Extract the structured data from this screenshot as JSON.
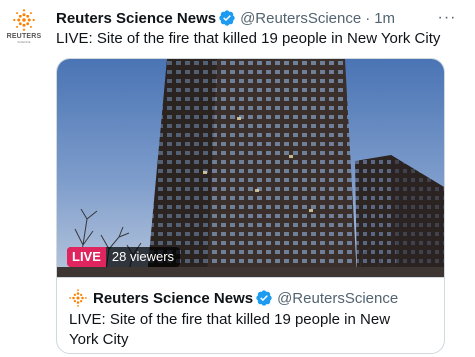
{
  "author": {
    "display_name": "Reuters Science News",
    "handle": "@ReutersScience",
    "separator": "·",
    "timestamp": "1m",
    "verified": true,
    "avatar_icon": "reuters-logo-icon",
    "avatar_brand": "REUTERS",
    "avatar_brand_sub": "SCIENCE"
  },
  "more_label": "···",
  "tweet_text": "LIVE: Site of the fire that killed 19 people in New York City",
  "media": {
    "live_label": "LIVE",
    "viewers_label": "28 viewers"
  },
  "card": {
    "author_name": "Reuters Science News",
    "author_handle": "@ReutersScience",
    "text": "LIVE: Site of the fire that killed 19 people in New York City"
  },
  "colors": {
    "verified_blue": "#1d9bf0",
    "live_pink": "#e0245e",
    "reuters_orange": "#ff8000",
    "secondary_text": "#536471"
  }
}
